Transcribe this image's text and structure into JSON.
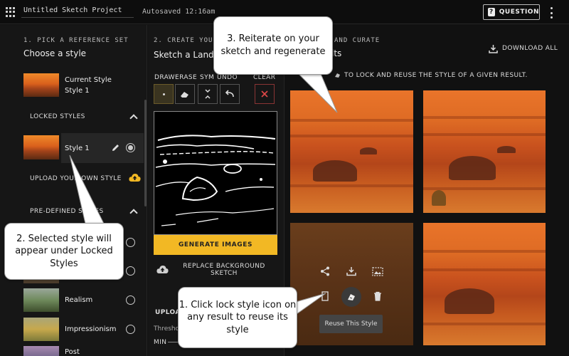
{
  "header": {
    "project_title": "Untitled Sketch Project",
    "autosave": "Autosaved 12:16am",
    "question_label": "QUESTION",
    "question_glyph": "?"
  },
  "step1": {
    "label": "1. PICK A REFERENCE SET",
    "title": "Choose a style",
    "current_style_label": "Current Style",
    "current_style_name": "Style 1",
    "locked_styles_label": "LOCKED STYLES",
    "locked_item_name": "Style 1",
    "upload_label": "UPLOAD YOUR OWN STYLE",
    "predefined_label": "PRE-DEFINED STYLES",
    "styles": [
      "Realism",
      "Impressionism",
      "Post"
    ]
  },
  "step2": {
    "label": "2. CREATE YOUR",
    "title": "Sketch a Land",
    "tools": [
      "DRAW",
      "ERASE",
      "SYM",
      "UNDO",
      "CLEAR"
    ],
    "generate_label": "GENERATE IMAGES",
    "replace_label_line1": "REPLACE BACKGROUND",
    "replace_label_line2": "SKETCH",
    "upload_label": "UPLOA",
    "threshold_label": "Thresho",
    "min_label": "MIN"
  },
  "step3": {
    "label_partial": "AND CURATE",
    "title_partial": "lts",
    "download_label": "DOWNLOAD ALL",
    "instruction": "TO LOCK AND REUSE THE STYLE OF A GIVEN RESULT.",
    "tooltip": "Reuse This Style"
  },
  "callouts": {
    "c1": "1. Click lock style icon on any result to reuse its style",
    "c2": "2. Selected style will appear under Locked Styles",
    "c3": "3. Reiterate on your sketch and regenerate"
  },
  "colors": {
    "accent": "#f2b824",
    "clear_red": "#d33a3a",
    "upload_cloud": "#f2b824"
  }
}
